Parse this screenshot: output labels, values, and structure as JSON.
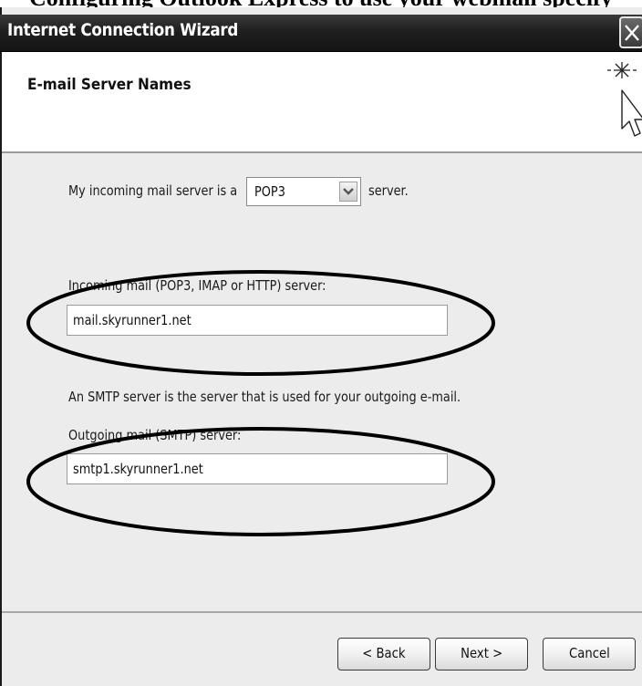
{
  "doc_text": "Configuring Outlook Express to use your webmail specify",
  "window": {
    "title": "Internet Connection Wizard",
    "close_icon": "close-x-icon"
  },
  "header": {
    "title": "E-mail Server Names",
    "icon": "wizard-cursor-icon"
  },
  "incoming_type": {
    "label_before": "My incoming mail server is a",
    "selected": "POP3",
    "label_after": "server."
  },
  "incoming": {
    "label": "Incoming mail (POP3, IMAP or HTTP) server:",
    "value": "mail.skyrunner1.net"
  },
  "smtp_note": "An SMTP server is the server that is used for your outgoing e-mail.",
  "outgoing": {
    "label": "Outgoing mail (SMTP) server:",
    "value": "smtp1.skyrunner1.net"
  },
  "buttons": {
    "back": "< Back",
    "next": "Next >",
    "cancel": "Cancel"
  },
  "colors": {
    "titlebar": "#1f1f1f",
    "dialog_bg": "#ececec",
    "annotation": "#000000"
  }
}
